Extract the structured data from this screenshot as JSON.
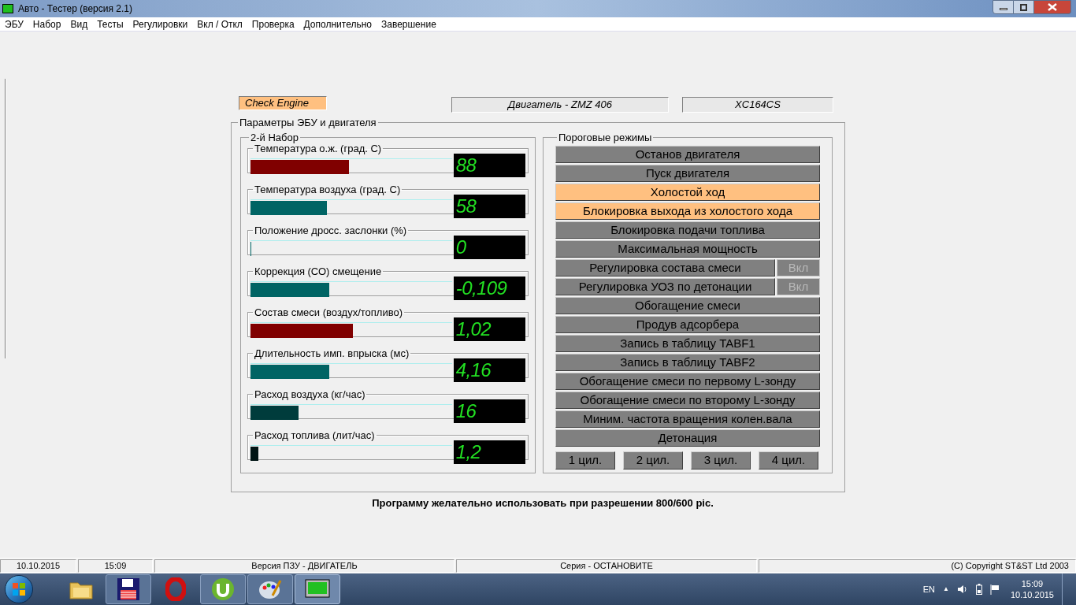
{
  "window": {
    "title": "Авто - Тестер  (версия 2.1)"
  },
  "menu": [
    "ЭБУ",
    "Набор",
    "Вид",
    "Тесты",
    "Регулировки",
    "Вкл / Откл",
    "Проверка",
    "Дополнительно",
    "Завершение"
  ],
  "header": {
    "check_engine": "Check Engine",
    "engine": "Двигатель - ZMZ 406",
    "controller": "XC164CS"
  },
  "params": {
    "title": "Параметры ЭБУ и двигателя",
    "group_title": "2-й  Набор",
    "gauges": [
      {
        "label": "Температура  о.ж. (град. С)",
        "value": "88",
        "level": 0.49,
        "color": "#800000"
      },
      {
        "label": "Температура воздуха (град. С)",
        "value": "58",
        "level": 0.38,
        "color": "#006464"
      },
      {
        "label": "Положение дросс. заслонки (%)",
        "value": "0",
        "level": 0,
        "color": "#006464"
      },
      {
        "label": "Коррекция (СО) смещение",
        "value": "-0,109",
        "level": 0.39,
        "color": "#006464"
      },
      {
        "label": "Состав смеси (воздух/топливо)",
        "value": "1,02",
        "level": 0.51,
        "color": "#800000"
      },
      {
        "label": "Длительность имп. впрыска (мс)",
        "value": "4,16",
        "level": 0.39,
        "color": "#006464"
      },
      {
        "label": "Расход воздуха (кг/час)",
        "value": "16",
        "level": 0.24,
        "color": "#003c3c"
      },
      {
        "label": "Расход топлива (лит/час)",
        "value": "1,2",
        "level": 0.04,
        "color": "#001414"
      }
    ]
  },
  "modes": {
    "title": "Пороговые режимы",
    "items": [
      {
        "label": "Останов двигателя",
        "selected": false
      },
      {
        "label": "Пуск двигателя",
        "selected": false
      },
      {
        "label": "Холостой ход",
        "selected": true
      },
      {
        "label": "Блокировка выхода из холостого хода",
        "selected": true
      },
      {
        "label": "Блокировка подачи топлива",
        "selected": false
      },
      {
        "label": "Максимальная мощность",
        "selected": false
      },
      {
        "label": "Регулировка состава смеси",
        "selected": false,
        "toggle": {
          "label": "Вкл",
          "disabled": true
        }
      },
      {
        "label": "Регулировка УОЗ по детонации",
        "selected": false,
        "toggle": {
          "label": "Вкл",
          "disabled": true
        }
      },
      {
        "label": "Обогащение смеси",
        "selected": false
      },
      {
        "label": "Продув адсорбера",
        "selected": false
      },
      {
        "label": "Запись в таблицу TABF1",
        "selected": false
      },
      {
        "label": "Запись в таблицу TABF2",
        "selected": false
      },
      {
        "label": "Обогащение смеси по первому L-зонду",
        "selected": false
      },
      {
        "label": "Обогащение смеси по второму L-зонду",
        "selected": false
      },
      {
        "label": "Миним. частота вращения колен.вала",
        "selected": false
      },
      {
        "label": "Детонация",
        "selected": false
      }
    ],
    "cylinders": [
      {
        "label": "1 цил.",
        "selected": false
      },
      {
        "label": "2 цил.",
        "selected": false
      },
      {
        "label": "3 цил.",
        "selected": false
      },
      {
        "label": "4 цил.",
        "selected": false
      }
    ]
  },
  "note": "Программу желательно использовать при разрешении 800/600 pic.",
  "status_bar": [
    "10.10.2015",
    "15:09",
    "Версия ПЗУ - ДВИГАТЕЛЬ",
    "Серия - ОСТАНОВИТЕ",
    "(C) Copyright   ST&ST  Ltd 2003"
  ],
  "taskbar": {
    "language": "EN",
    "tray_caret": "▲",
    "time": "15:09",
    "date": "10.10.2015"
  }
}
